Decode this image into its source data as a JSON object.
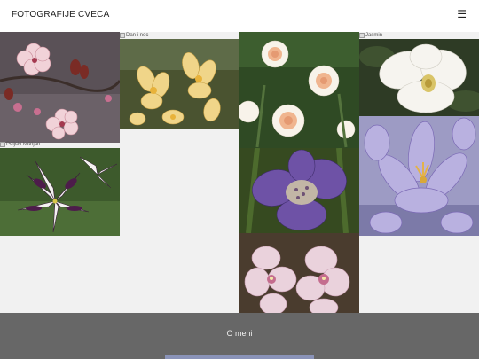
{
  "header": {
    "title": "FOTOGRAFIJE CVECA",
    "menu_icon": "hamburger-icon",
    "menu_glyph": "☰"
  },
  "gallery": {
    "tiles": [
      {
        "id": "cherry-blossom",
        "alt": ""
      },
      {
        "id": "dan-i-noc",
        "alt": "Dan i noc"
      },
      {
        "id": "peach-daffodils",
        "alt": ""
      },
      {
        "id": "jasmin",
        "alt": "Jasmin"
      },
      {
        "id": "poljski-kotrljan",
        "alt": "Poljski kotrljan"
      },
      {
        "id": "purple-crocus",
        "alt": ""
      },
      {
        "id": "iris",
        "alt": ""
      },
      {
        "id": "pink-orchid",
        "alt": ""
      }
    ]
  },
  "footer": {
    "link_label": "O meni"
  }
}
